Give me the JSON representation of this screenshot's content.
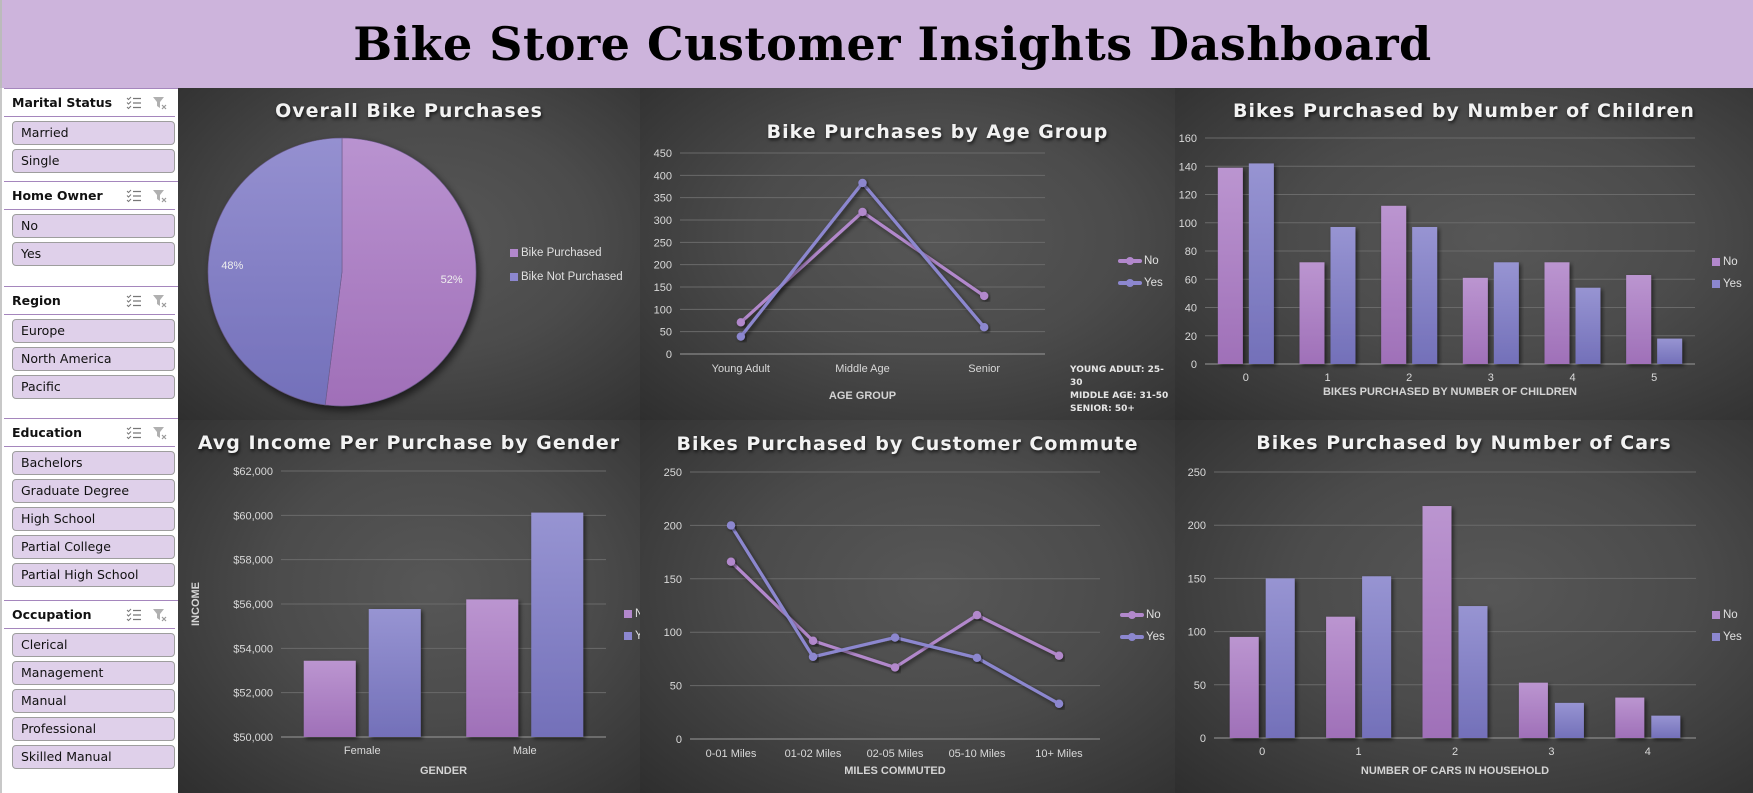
{
  "header": {
    "title": "Bike Store Customer Insights Dashboard"
  },
  "colors": {
    "no": "#b288cc",
    "yes": "#8c87cf",
    "no_dark": "#9f70b8",
    "yes_dark": "#7370b9",
    "header_bg": "#cdb4dc",
    "slicer_item_bg": "#dfd0ea"
  },
  "icons": {
    "multiselect": "multi-select-icon",
    "clear_filter": "clear-filter-icon"
  },
  "sidebar": {
    "slicers": [
      {
        "title": "Marital Status",
        "items": [
          "Married",
          "Single"
        ]
      },
      {
        "title": "Home Owner",
        "items": [
          "No",
          "Yes"
        ]
      },
      {
        "title": "Region",
        "items": [
          "Europe",
          "North America",
          "Pacific"
        ]
      },
      {
        "title": "Education",
        "items": [
          "Bachelors",
          "Graduate Degree",
          "High School",
          "Partial College",
          "Partial High School"
        ]
      },
      {
        "title": "Occupation",
        "items": [
          "Clerical",
          "Management",
          "Manual",
          "Professional",
          "Skilled Manual"
        ]
      }
    ]
  },
  "chart_data": [
    {
      "id": "overall",
      "type": "pie",
      "title": "Overall Bike Purchases",
      "slices": [
        {
          "label": "Bike Purchased",
          "value": 52,
          "display": "52%"
        },
        {
          "label": "Bike Not Purchased",
          "value": 48,
          "display": "48%"
        }
      ],
      "legend": "right"
    },
    {
      "id": "age",
      "type": "line",
      "title": "Bike Purchases by Age Group",
      "categories": [
        "Young Adult",
        "Middle Age",
        "Senior"
      ],
      "series": [
        {
          "name": "No",
          "values": [
            71,
            318,
            130
          ]
        },
        {
          "name": "Yes",
          "values": [
            39,
            383,
            60
          ]
        }
      ],
      "xlabel": "AGE GROUP",
      "ylabel": "",
      "ylim": [
        0,
        450
      ],
      "yticks": [
        0,
        50,
        100,
        150,
        200,
        250,
        300,
        350,
        400,
        450
      ],
      "ytick_labels": [
        "0",
        "50",
        "100",
        "150",
        "200",
        "250",
        "300",
        "350",
        "400",
        "450"
      ],
      "grid": true,
      "legend": "right",
      "note": [
        "YOUNG ADULT: 25-30",
        "MIDDLE AGE: 31-50",
        "SENIOR: 50+"
      ]
    },
    {
      "id": "children",
      "type": "bar",
      "title": "Bikes Purchased by Number of Children",
      "categories": [
        "0",
        "1",
        "2",
        "3",
        "4",
        "5"
      ],
      "series": [
        {
          "name": "No",
          "values": [
            139,
            72,
            112,
            61,
            72,
            63
          ]
        },
        {
          "name": "Yes",
          "values": [
            142,
            97,
            97,
            72,
            54,
            18
          ]
        }
      ],
      "xlabel": "BIKES PURCHASED BY NUMBER OF CHILDREN",
      "ylabel": "",
      "ylim": [
        0,
        160
      ],
      "yticks": [
        0,
        20,
        40,
        60,
        80,
        100,
        120,
        140,
        160
      ],
      "ytick_labels": [
        "0",
        "20",
        "40",
        "60",
        "80",
        "100",
        "120",
        "140",
        "160"
      ],
      "grid": true,
      "legend": "right"
    },
    {
      "id": "income",
      "type": "bar",
      "title": "Avg Income Per Purchase by Gender",
      "categories": [
        "Female",
        "Male"
      ],
      "series": [
        {
          "name": "No",
          "values": [
            53440,
            56208
          ]
        },
        {
          "name": "Yes",
          "values": [
            55774,
            60124
          ]
        }
      ],
      "xlabel": "GENDER",
      "ylabel": "INCOME",
      "ylim": [
        50000,
        62000
      ],
      "yticks": [
        50000,
        52000,
        54000,
        56000,
        58000,
        60000,
        62000
      ],
      "ytick_labels": [
        "$50,000",
        "$52,000",
        "$54,000",
        "$56,000",
        "$58,000",
        "$60,000",
        "$62,000"
      ],
      "grid": true,
      "legend": "right"
    },
    {
      "id": "commute",
      "type": "line",
      "title": "Bikes Purchased by Customer Commute",
      "categories": [
        "0-01 Miles",
        "01-02 Miles",
        "02-05 Miles",
        "05-10 Miles",
        "10+ Miles"
      ],
      "series": [
        {
          "name": "No",
          "values": [
            166,
            92,
            67,
            116,
            78
          ]
        },
        {
          "name": "Yes",
          "values": [
            200,
            77,
            95,
            76,
            33
          ]
        }
      ],
      "xlabel": "MILES COMMUTED",
      "ylabel": "",
      "ylim": [
        0,
        250
      ],
      "yticks": [
        0,
        50,
        100,
        150,
        200,
        250
      ],
      "ytick_labels": [
        "0",
        "50",
        "100",
        "150",
        "200",
        "250"
      ],
      "grid": true,
      "legend": "right"
    },
    {
      "id": "cars",
      "type": "bar",
      "title": "Bikes Purchased by Number of Cars",
      "categories": [
        "0",
        "1",
        "2",
        "3",
        "4"
      ],
      "series": [
        {
          "name": "No",
          "values": [
            95,
            114,
            218,
            52,
            38
          ]
        },
        {
          "name": "Yes",
          "values": [
            150,
            152,
            124,
            33,
            21
          ]
        }
      ],
      "xlabel": "NUMBER OF CARS IN HOUSEHOLD",
      "ylabel": "",
      "ylim": [
        0,
        250
      ],
      "yticks": [
        0,
        50,
        100,
        150,
        200,
        250
      ],
      "ytick_labels": [
        "0",
        "50",
        "100",
        "150",
        "200",
        "250"
      ],
      "grid": true,
      "legend": "right"
    }
  ]
}
